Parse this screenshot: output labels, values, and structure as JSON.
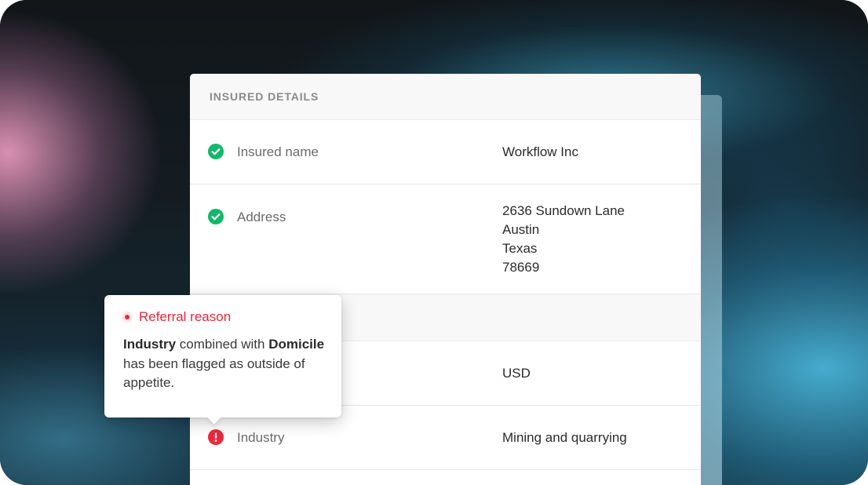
{
  "section": {
    "title": "INSURED DETAILS"
  },
  "rows": [
    {
      "status": "check-circle-icon",
      "label": "Insured name",
      "value": "Workflow Inc"
    },
    {
      "status": "check-circle-icon",
      "label": "Address",
      "value_lines": [
        "2636 Sundown Lane",
        "Austin",
        "Texas",
        "78669"
      ]
    },
    {
      "status": "",
      "label": "",
      "value": "USD"
    },
    {
      "status": "alert-circle-icon",
      "label": "Industry",
      "value": "Mining and quarrying"
    }
  ],
  "tooltip": {
    "title": "Referral reason",
    "body_bold_1": "Industry",
    "body_text_1": " combined with ",
    "body_bold_2": "Domicile",
    "body_text_2": " has been flagged as outside of appetite."
  },
  "colors": {
    "success": "#12b76a",
    "error": "#ea2a3c",
    "section_header_bg": "#f8f8f8"
  }
}
